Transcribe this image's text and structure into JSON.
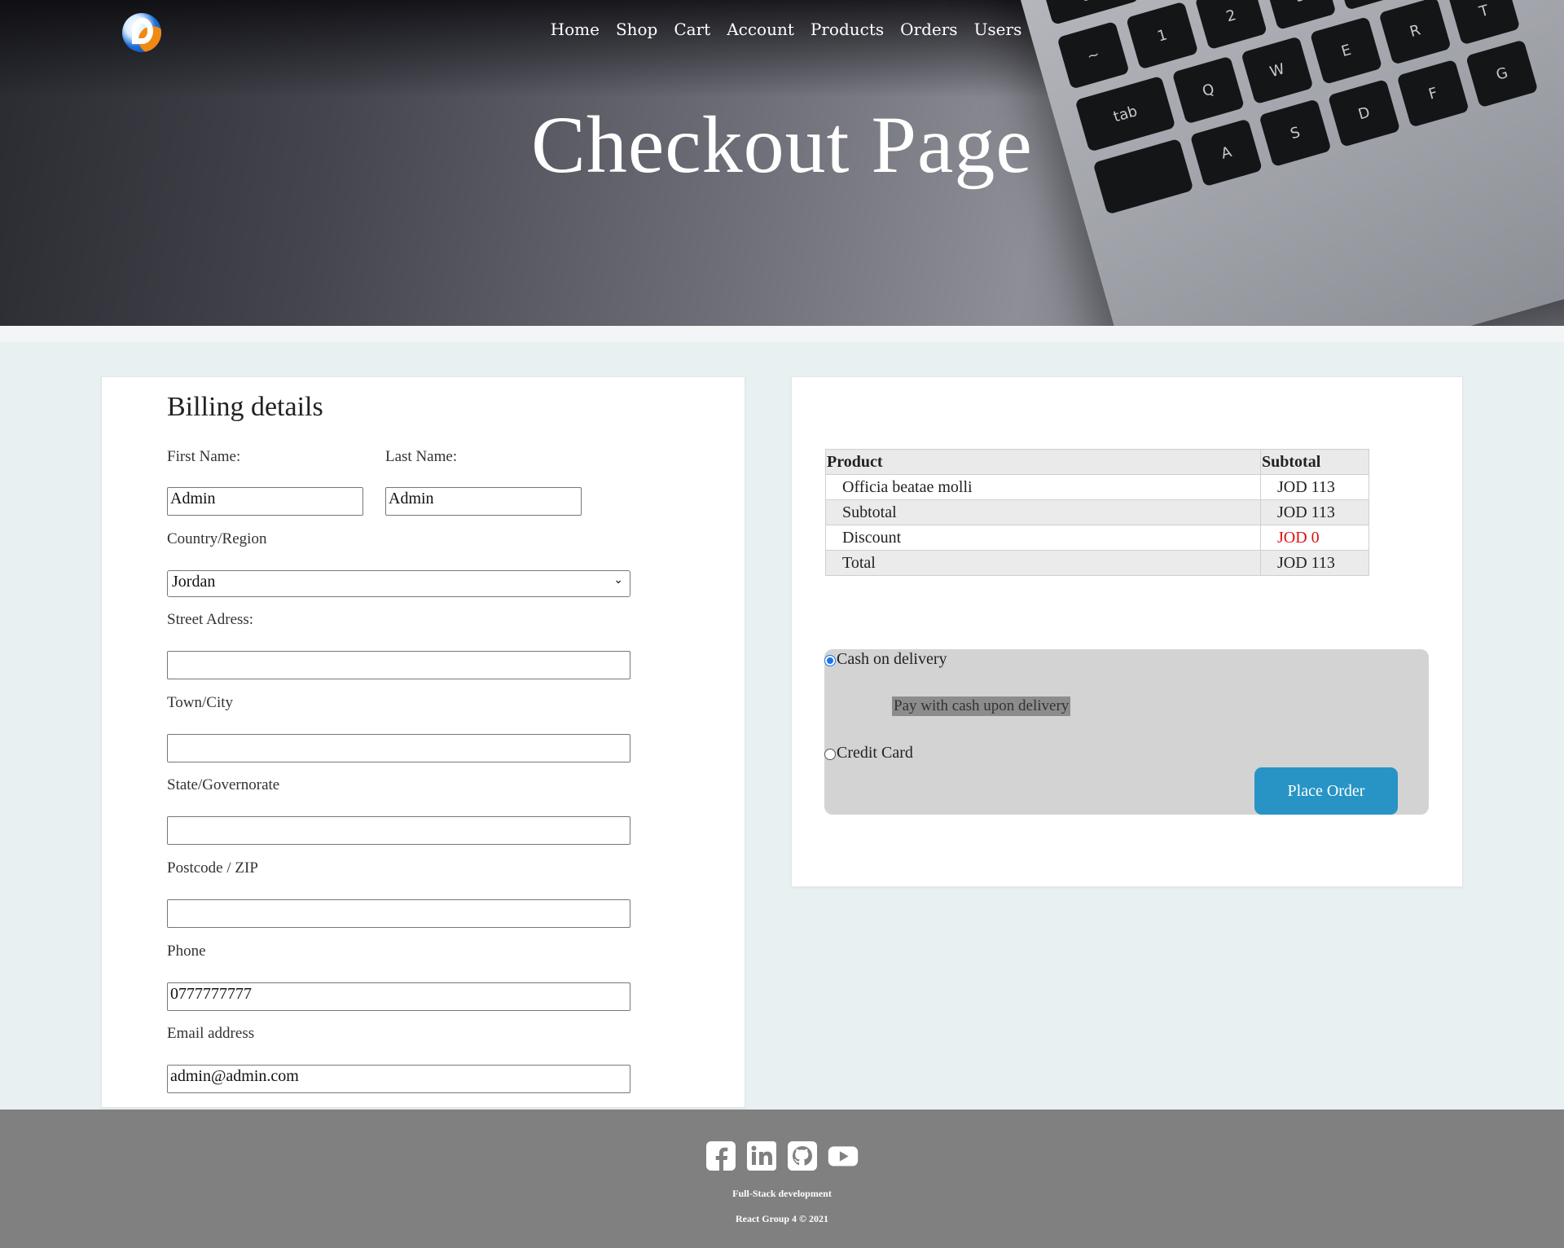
{
  "nav": {
    "items": [
      "Home",
      "Shop",
      "Cart",
      "Account",
      "Products",
      "Orders",
      "Users"
    ]
  },
  "hero": {
    "title": "Checkout Page"
  },
  "billing": {
    "heading": "Billing details",
    "first_name_label": "First Name:",
    "first_name_value": "Admin",
    "last_name_label": "Last Name:",
    "last_name_value": "Admin",
    "country_label": "Country/Region",
    "country_value": "Jordan",
    "street_label": "Street Adress:",
    "street_value": "",
    "city_label": "Town/City",
    "city_value": "",
    "state_label": "State/Governorate",
    "state_value": "",
    "postcode_label": "Postcode / ZIP",
    "postcode_value": "",
    "phone_label": "Phone",
    "phone_value": "0777777777",
    "email_label": "Email address",
    "email_value": "admin@admin.com"
  },
  "order": {
    "headers": {
      "product": "Product",
      "subtotal": "Subtotal"
    },
    "rows": [
      {
        "label": "Officia beatae molli",
        "value": "JOD 113"
      },
      {
        "label": "Subtotal",
        "value": "JOD 113"
      },
      {
        "label": "Discount",
        "value": "JOD 0"
      },
      {
        "label": "Total",
        "value": "JOD 113"
      }
    ],
    "discount_color": "#dd1111"
  },
  "payment": {
    "cash_label": "Cash on delivery",
    "cash_note": "Pay with cash upon delivery",
    "card_label": "Credit Card",
    "selected": "cash",
    "place_order": "Place Order",
    "button_color": "#2794c5"
  },
  "footer": {
    "icons": [
      "facebook-icon",
      "linkedin-icon",
      "github-icon",
      "youtube-icon"
    ],
    "line1": "Full-Stack development",
    "line2": "React Group 4 © 2021"
  }
}
